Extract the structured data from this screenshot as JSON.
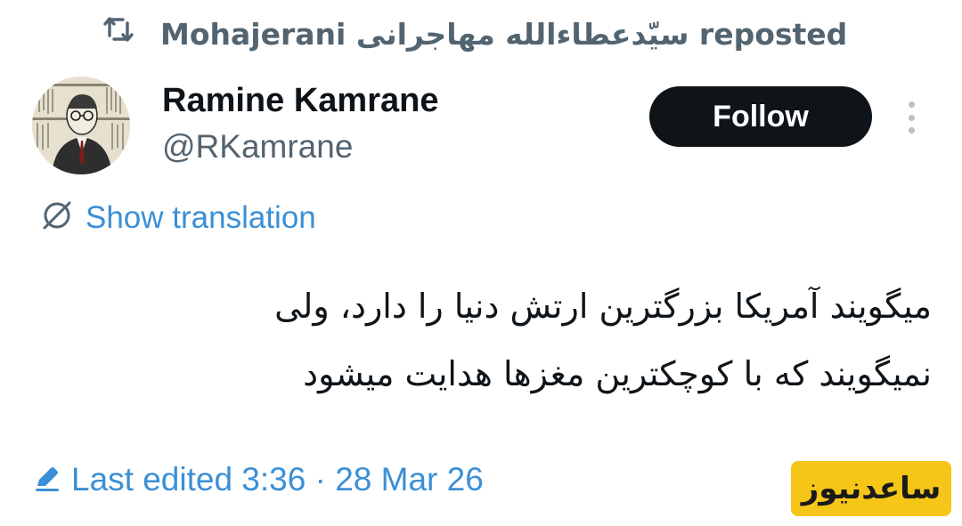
{
  "repost": {
    "icon": "repost-icon",
    "text": "Mohajerani سیّدعطاءالله مهاجرانی reposted"
  },
  "author": {
    "name": "Ramine Kamrane",
    "handle": "@RKamrane",
    "avatar_icon": "avatar-portrait"
  },
  "actions": {
    "follow_label": "Follow",
    "more_icon": "more-vertical-icon"
  },
  "translation": {
    "icon": "translate-globe-icon",
    "label": "Show translation"
  },
  "tweet": {
    "lines": [
      "میگویند آمریکا بزرگترین ارتش دنیا را دارد، ولی",
      "نمیگویند که با کوچکترین مغزها هدایت میشود"
    ]
  },
  "edited": {
    "icon": "edit-pencil-icon",
    "label": "Last edited 3:36 · 28 Mar 26"
  },
  "watermark": {
    "text": "ساعدنیوز",
    "background": "#f5c518",
    "color": "#1a1a1a"
  },
  "colors": {
    "text_primary": "#0f1419",
    "text_secondary": "#536471",
    "link": "#3b8fd6",
    "button_bg": "#0f1419"
  }
}
